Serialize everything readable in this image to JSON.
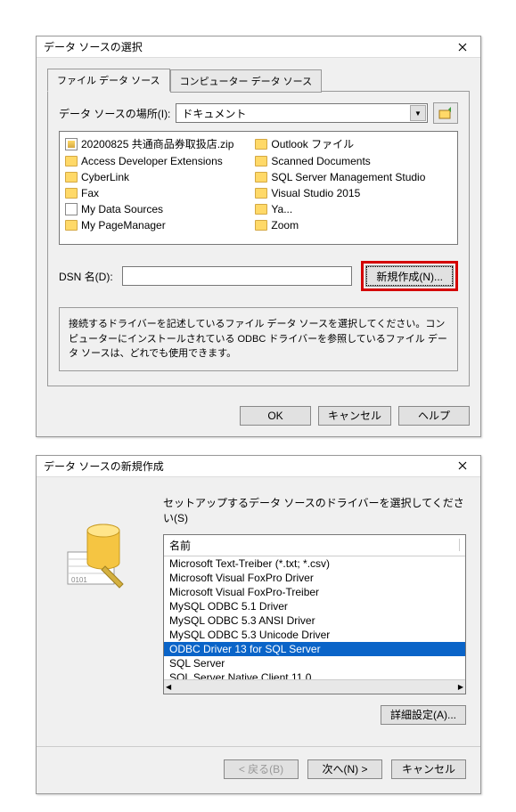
{
  "dialog1": {
    "title": "データ ソースの選択",
    "tabs": [
      {
        "label": "ファイル データ ソース",
        "active": true
      },
      {
        "label": "コンピューター データ ソース",
        "active": false
      }
    ],
    "locationLabel": "データ ソースの場所(I):",
    "locationValue": "ドキュメント",
    "files_col1": [
      {
        "icon": "zip",
        "name": "20200825 共通商品券取扱店.zip"
      },
      {
        "icon": "folder",
        "name": "Access Developer Extensions"
      },
      {
        "icon": "folder",
        "name": "CyberLink"
      },
      {
        "icon": "folder",
        "name": "Fax"
      },
      {
        "icon": "special",
        "name": "My Data Sources"
      },
      {
        "icon": "folder",
        "name": "My PageManager"
      }
    ],
    "files_col2": [
      {
        "icon": "folder",
        "name": "Outlook ファイル"
      },
      {
        "icon": "folder",
        "name": "Scanned Documents"
      },
      {
        "icon": "folder",
        "name": "SQL Server Management Studio"
      },
      {
        "icon": "folder",
        "name": "Visual Studio 2015"
      },
      {
        "icon": "folder",
        "name": "Ya..."
      },
      {
        "icon": "folder",
        "name": "Zoom"
      }
    ],
    "dsnLabel": "DSN 名(D):",
    "dsnValue": "",
    "newBtn": "新規作成(N)...",
    "helpText": "接続するドライバーを記述しているファイル データ ソースを選択してください。コンピューターにインストールされている ODBC ドライバーを参照しているファイル データ ソースは、どれでも使用できます。",
    "okBtn": "OK",
    "cancelBtn": "キャンセル",
    "helpBtn": "ヘルプ"
  },
  "dialog2": {
    "title": "データ ソースの新規作成",
    "instruction": "セットアップするデータ ソースのドライバーを選択してください(S)",
    "listHeader": "名前",
    "drivers": [
      {
        "name": "Microsoft Text-Treiber (*.txt; *.csv)",
        "selected": false
      },
      {
        "name": "Microsoft Visual FoxPro Driver",
        "selected": false
      },
      {
        "name": "Microsoft Visual FoxPro-Treiber",
        "selected": false
      },
      {
        "name": "MySQL ODBC 5.1 Driver",
        "selected": false
      },
      {
        "name": "MySQL ODBC 5.3 ANSI Driver",
        "selected": false
      },
      {
        "name": "MySQL ODBC 5.3 Unicode Driver",
        "selected": false
      },
      {
        "name": "ODBC Driver 13 for SQL Server",
        "selected": true
      },
      {
        "name": "SQL Server",
        "selected": false
      },
      {
        "name": "SQL Server Native Client 11.0",
        "selected": false
      }
    ],
    "advancedBtn": "詳細設定(A)...",
    "backBtn": "< 戻る(B)",
    "nextBtn": "次へ(N) >",
    "cancelBtn": "キャンセル"
  }
}
